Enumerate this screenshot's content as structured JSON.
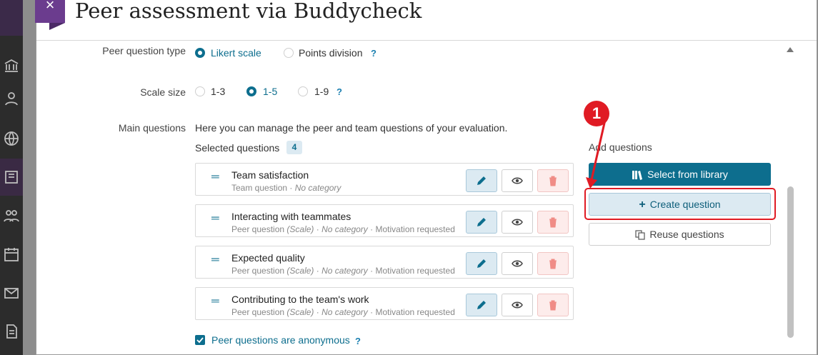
{
  "modal": {
    "title": "Peer assessment via Buddycheck",
    "close_glyph": "×"
  },
  "peer_question_type": {
    "label": "Peer question type",
    "options": [
      "Likert scale",
      "Points division"
    ],
    "selected": "Likert scale",
    "help": "?"
  },
  "scale_size": {
    "label": "Scale size",
    "options": [
      "1-3",
      "1-5",
      "1-9"
    ],
    "selected": "1-5",
    "help": "?"
  },
  "main_questions": {
    "label": "Main questions",
    "description": "Here you can manage the peer and team questions of your evaluation.",
    "selected_label": "Selected questions",
    "selected_count": "4",
    "questions": [
      {
        "title": "Team satisfaction",
        "type": "Team question",
        "scale": "",
        "category": "No category",
        "motivation": ""
      },
      {
        "title": "Interacting with teammates",
        "type": "Peer question",
        "scale": "(Scale)",
        "category": "No category",
        "motivation": "Motivation requested"
      },
      {
        "title": "Expected quality",
        "type": "Peer question",
        "scale": "(Scale)",
        "category": "No category",
        "motivation": "Motivation requested"
      },
      {
        "title": "Contributing to the team's work",
        "type": "Peer question",
        "scale": "(Scale)",
        "category": "No category",
        "motivation": "Motivation requested"
      }
    ]
  },
  "add_questions": {
    "title": "Add questions",
    "select_from_library": "Select from library",
    "create_question": "Create question",
    "reuse_questions": "Reuse questions"
  },
  "anonymous": {
    "label": "Peer questions are anonymous",
    "checked": true,
    "help": "?"
  },
  "annotation": {
    "step_number": "1"
  },
  "colors": {
    "accent": "#0d6e8e",
    "brand_purple": "#6b3c8e",
    "annotation_red": "#e01b24"
  }
}
